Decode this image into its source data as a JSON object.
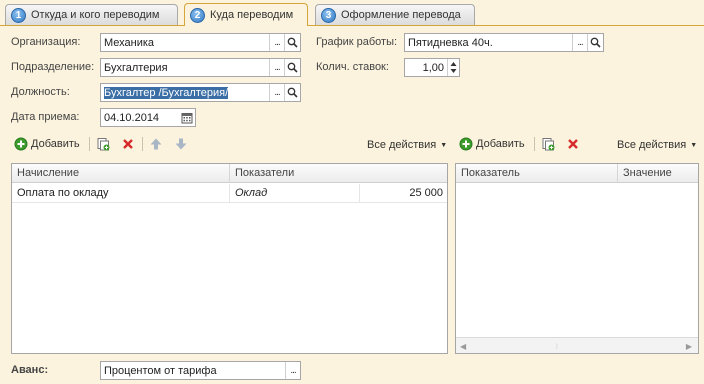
{
  "tabs": [
    {
      "num": "1",
      "label": "Откуда и кого переводим"
    },
    {
      "num": "2",
      "label": "Куда переводим"
    },
    {
      "num": "3",
      "label": "Оформление перевода"
    }
  ],
  "form": {
    "organization_label": "Организация:",
    "organization_value": "Механика",
    "department_label": "Подразделение:",
    "department_value": "Бухгалтерия",
    "position_label": "Должность:",
    "position_value": "Бухгалтер /Бухгалтерия/",
    "hire_date_label": "Дата приема:",
    "hire_date_value": "04.10.2014",
    "schedule_label": "График работы:",
    "schedule_value": "Пятидневка 40ч.",
    "rates_label": "Колич. ставок:",
    "rates_value": "1,00",
    "dots": "...",
    "advance_label": "Аванс:",
    "advance_value": "Процентом от тарифа"
  },
  "left_toolbar": {
    "add_label": "Добавить",
    "all_actions_label": "Все действия"
  },
  "right_toolbar": {
    "add_label": "Добавить",
    "all_actions_label": "Все действия"
  },
  "left_table": {
    "columns": [
      "Начисление",
      "Показатели"
    ],
    "rows": [
      {
        "accrual": "Оплата по окладу",
        "indicator": "Оклад",
        "value": "25 000"
      }
    ]
  },
  "right_table": {
    "columns": [
      "Показатель",
      "Значение"
    ]
  },
  "colors": {
    "background": "#fbf3dd",
    "tab_active_border": "#d4a63a",
    "selection": "#3a6ea5",
    "add_icon": "#3d9b2e",
    "delete_icon": "#d62b2b"
  },
  "icons": {
    "tab_number": "circle-number-icon",
    "select": "ellipsis-icon",
    "search": "magnifier-icon",
    "calendar": "calendar-icon",
    "spinner": "spinner-arrows-icon",
    "add": "plus-circle-icon",
    "copy": "copy-icon",
    "delete": "red-x-icon",
    "up": "arrow-up-icon",
    "down": "arrow-down-icon",
    "dropdown": "caret-down-icon"
  }
}
